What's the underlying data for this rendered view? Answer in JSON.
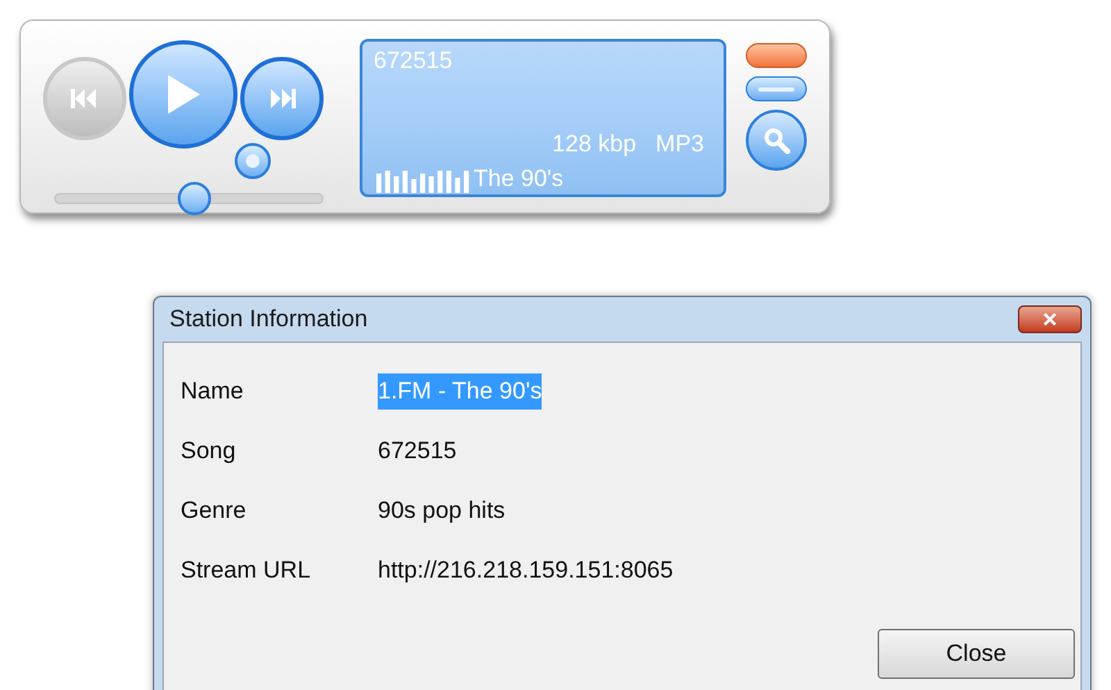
{
  "player": {
    "transport": [
      {
        "kind": "prev",
        "disabled": true
      },
      {
        "kind": "play",
        "disabled": false
      },
      {
        "kind": "next",
        "disabled": false
      }
    ],
    "volume": {
      "level": 0.52
    },
    "display": {
      "song": "672515",
      "bitrate": "128 kbp",
      "format": "MP3",
      "station": "The 90's"
    }
  },
  "dialog": {
    "title": "Station Information",
    "close_glyph": "×",
    "rows": [
      {
        "label": "Name",
        "value": "1.FM - The 90's",
        "highlighted": true
      },
      {
        "label": "Song",
        "value": "672515",
        "highlighted": false
      },
      {
        "label": "Genre",
        "value": "90s pop hits",
        "highlighted": false
      },
      {
        "label": "Stream URL",
        "value": "http://216.218.159.151:8065",
        "highlighted": false
      }
    ],
    "button": "Close"
  }
}
